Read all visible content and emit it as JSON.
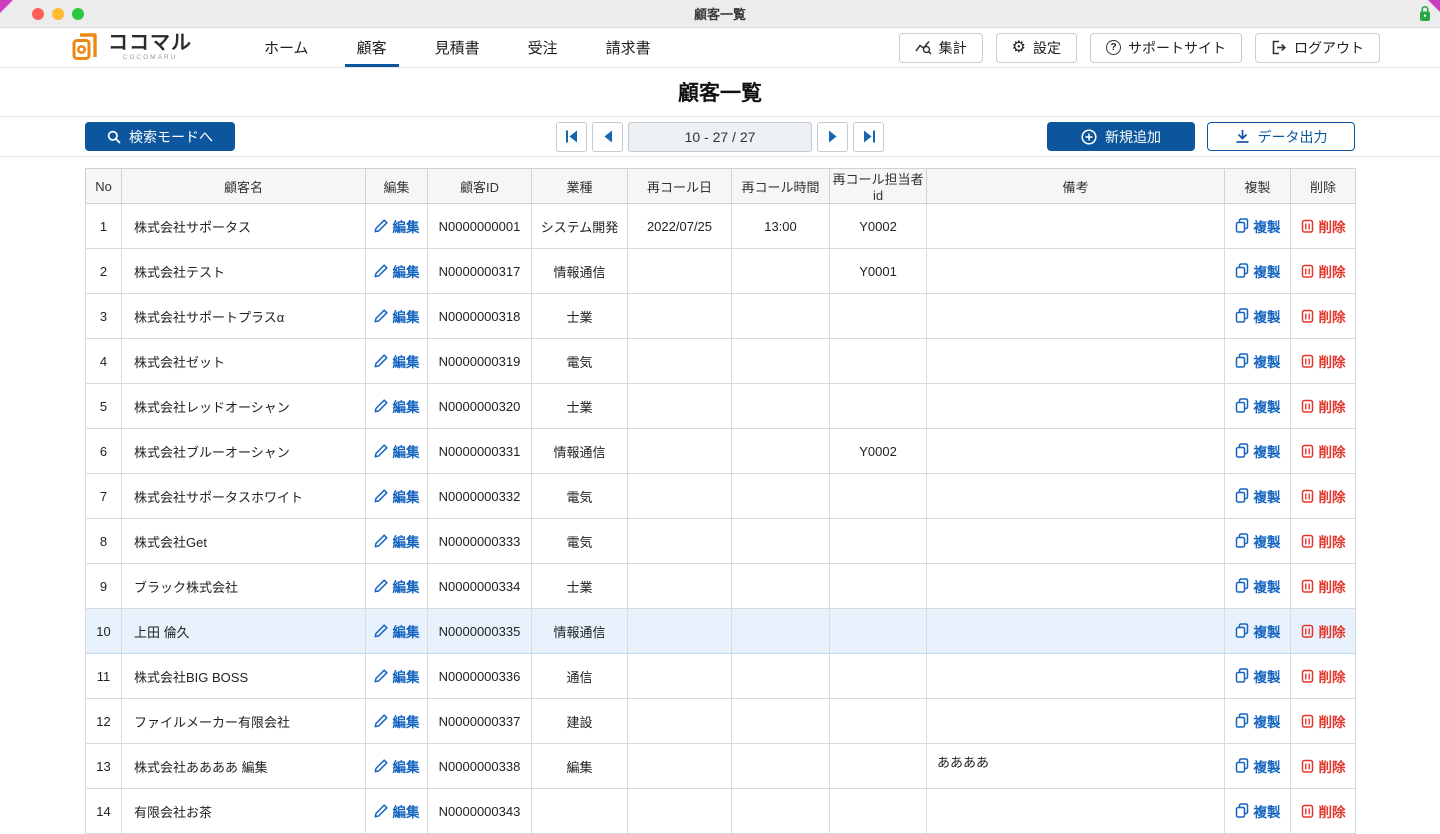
{
  "window": {
    "title": "顧客一覧"
  },
  "colors": {
    "primary_blue": "#0D569E",
    "link_blue": "#1565C0",
    "danger_red": "#E3362C",
    "brand_orange": "#EE8814",
    "row_highlight": "#E8F2FC"
  },
  "nav": {
    "brand": {
      "name": "ココマル",
      "subname": "COCOMARU"
    },
    "tabs": [
      {
        "label": "ホーム"
      },
      {
        "label": "顧客"
      },
      {
        "label": "見積書"
      },
      {
        "label": "受注"
      },
      {
        "label": "請求書"
      }
    ],
    "actions": [
      {
        "label": "集計"
      },
      {
        "label": "設定"
      },
      {
        "label": "サポートサイト"
      },
      {
        "label": "ログアウト"
      }
    ]
  },
  "page": {
    "title": "顧客一覧"
  },
  "toolbar": {
    "search_button": "検索モードへ",
    "pagination": {
      "range_text": "10 - 27 / 27"
    },
    "add_button": "新規追加",
    "export_button": "データ出力"
  },
  "table": {
    "headers": [
      "No",
      "顧客名",
      "編集",
      "顧客ID",
      "業種",
      "再コール日",
      "再コール時間",
      "再コール担当者id",
      "備考",
      "複製",
      "削除"
    ],
    "edit_label": "編集",
    "copy_label": "複製",
    "delete_label": "削除",
    "rows": [
      {
        "no": "1",
        "name": "株式会社サポータス",
        "id": "N0000000001",
        "industry": "システム開発",
        "recall_date": "2022/07/25",
        "recall_time": "13:00",
        "recall_person": "Y0002",
        "note": "",
        "highlighted": false
      },
      {
        "no": "2",
        "name": "株式会社テスト",
        "id": "N0000000317",
        "industry": "情報通信",
        "recall_date": "",
        "recall_time": "",
        "recall_person": "Y0001",
        "note": "",
        "highlighted": false
      },
      {
        "no": "3",
        "name": "株式会社サポートプラスα",
        "id": "N0000000318",
        "industry": "士業",
        "recall_date": "",
        "recall_time": "",
        "recall_person": "",
        "note": "",
        "highlighted": false
      },
      {
        "no": "4",
        "name": "株式会社ゼット",
        "id": "N0000000319",
        "industry": "電気",
        "recall_date": "",
        "recall_time": "",
        "recall_person": "",
        "note": "",
        "highlighted": false
      },
      {
        "no": "5",
        "name": "株式会社レッドオーシャン",
        "id": "N0000000320",
        "industry": "士業",
        "recall_date": "",
        "recall_time": "",
        "recall_person": "",
        "note": "",
        "highlighted": false
      },
      {
        "no": "6",
        "name": "株式会社ブルーオーシャン",
        "id": "N0000000331",
        "industry": "情報通信",
        "recall_date": "",
        "recall_time": "",
        "recall_person": "Y0002",
        "note": "",
        "highlighted": false
      },
      {
        "no": "7",
        "name": "株式会社サポータスホワイト",
        "id": "N0000000332",
        "industry": "電気",
        "recall_date": "",
        "recall_time": "",
        "recall_person": "",
        "note": "",
        "highlighted": false
      },
      {
        "no": "8",
        "name": "株式会社Get",
        "id": "N0000000333",
        "industry": "電気",
        "recall_date": "",
        "recall_time": "",
        "recall_person": "",
        "note": "",
        "highlighted": false
      },
      {
        "no": "9",
        "name": "ブラック株式会社",
        "id": "N0000000334",
        "industry": "士業",
        "recall_date": "",
        "recall_time": "",
        "recall_person": "",
        "note": "",
        "highlighted": false
      },
      {
        "no": "10",
        "name": "上田 倫久",
        "id": "N0000000335",
        "industry": "情報通信",
        "recall_date": "",
        "recall_time": "",
        "recall_person": "",
        "note": "",
        "highlighted": true
      },
      {
        "no": "11",
        "name": "株式会社BIG BOSS",
        "id": "N0000000336",
        "industry": "通信",
        "recall_date": "",
        "recall_time": "",
        "recall_person": "",
        "note": "",
        "highlighted": false
      },
      {
        "no": "12",
        "name": "ファイルメーカー有限会社",
        "id": "N0000000337",
        "industry": "建設",
        "recall_date": "",
        "recall_time": "",
        "recall_person": "",
        "note": "",
        "highlighted": false
      },
      {
        "no": "13",
        "name": "株式会社ああああ 編集",
        "id": "N0000000338",
        "industry": "編集",
        "recall_date": "",
        "recall_time": "",
        "recall_person": "",
        "note": "ああああ",
        "highlighted": false
      },
      {
        "no": "14",
        "name": "有限会社お茶",
        "id": "N0000000343",
        "industry": "",
        "recall_date": "",
        "recall_time": "",
        "recall_person": "",
        "note": "",
        "highlighted": false
      }
    ]
  }
}
